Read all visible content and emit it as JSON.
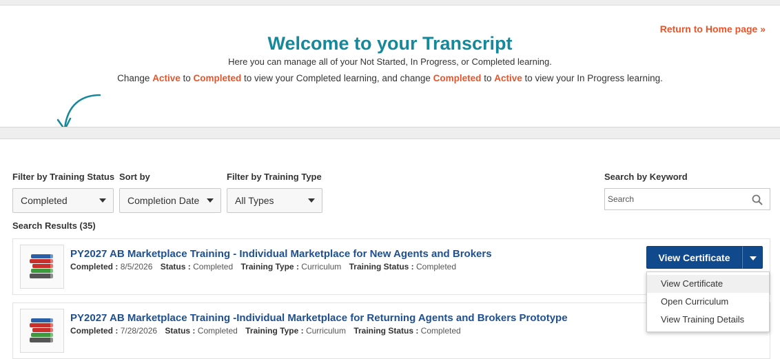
{
  "header": {
    "home_link": "Return to Home page »",
    "title": "Welcome to your Transcript",
    "intro": "Here you can manage all of your Not Started, In Progress, or Completed learning.",
    "instruction": {
      "p1": "Change ",
      "w1": "Active",
      "p2": " to ",
      "w2": "Completed",
      "p3": " to view your Completed learning, and change ",
      "w3": "Completed",
      "p4": " to ",
      "w4": "Active",
      "p5": " to view your In Progress learning."
    }
  },
  "filters": {
    "status": {
      "label": "Filter by Training Status",
      "value": "Completed"
    },
    "sort": {
      "label": "Sort by",
      "value": "Completion Date"
    },
    "type": {
      "label": "Filter by Training Type",
      "value": "All Types"
    },
    "search": {
      "label": "Search by Keyword",
      "placeholder": "Search"
    }
  },
  "results": {
    "count_label": "Search Results (35)",
    "meta_labels": {
      "completed": "Completed :",
      "status": "Status :",
      "training_type": "Training Type :",
      "training_status": "Training Status :"
    },
    "items": [
      {
        "title": "PY2027 AB Marketplace Training - Individual Marketplace for New Agents and Brokers",
        "completed": "8/5/2026",
        "status": "Completed",
        "training_type": "Curriculum",
        "training_status": "Completed"
      },
      {
        "title": "PY2027 AB Marketplace Training -Individual Marketplace for Returning Agents and Brokers Prototype",
        "completed": "7/28/2026",
        "status": "Completed",
        "training_type": "Curriculum",
        "training_status": "Completed"
      }
    ]
  },
  "action_button": {
    "label": "View Certificate",
    "menu": [
      "View Certificate",
      "Open Curriculum",
      "View Training Details"
    ]
  },
  "colors": {
    "accent_teal": "#16889a",
    "highlight_orange": "#e8542a",
    "title_blue": "#1d4f91",
    "button_blue": "#114a8c"
  },
  "icons": [
    "arrow-down-icon",
    "caret-down-icon",
    "search-icon",
    "books-icon"
  ]
}
